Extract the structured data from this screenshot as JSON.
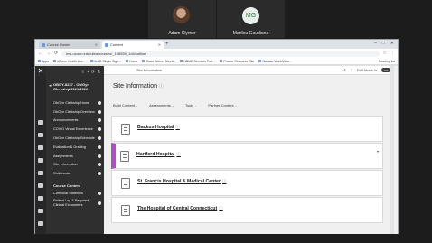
{
  "participants": [
    {
      "name": "Adam Clymer",
      "avatar_type": "photo"
    },
    {
      "name": "Marilou Gaudiana",
      "initials": "MG"
    }
  ],
  "browser": {
    "tabs": [
      {
        "label": "Course Roster",
        "active": false
      },
      {
        "label": "Content",
        "active": true
      }
    ],
    "new_tab": "+",
    "url": "lms.uconn.edu/ultra/courses/_108559_1/cl/outline",
    "bookmarks": [
      "Apps",
      "UConn Health Acc...",
      "NetID Single Sign...",
      "Home",
      "Cisco Webex Meeti...",
      "NBME Services Port...",
      "Proctor Resource Site",
      "Novasu WorldView...",
      "Reading list"
    ]
  },
  "course": {
    "title": "OBGY-8237 - Ob/Gyn Clerkship 2021/2022",
    "header_crumb": "OBGY-8237 - Ob/Gyn Clerkship 2021/2022",
    "nav_items": [
      "ObGyn Clerkship Home",
      "ObGyn Clerkship Overview",
      "Announcements",
      "COVID Virtual Experience",
      "ObGyn Clerkship Schedule",
      "Evaluation & Grading",
      "Assignments",
      "Site Information",
      "Collaborate"
    ],
    "section_label": "Course Content",
    "section_items": [
      "Curricular Materials",
      "Patient Log & Required Clinical Encounters"
    ]
  },
  "main": {
    "crumb": "Site Information",
    "edit_mode_label": "Edit Mode is",
    "edit_mode_state": "ON",
    "title": "Site Information",
    "menus": [
      "Build Content",
      "Assessments",
      "Tools",
      "Partner Content"
    ],
    "items": [
      {
        "label": "Backus Hospital",
        "highlight": false
      },
      {
        "label": "Hartford Hospital",
        "highlight": true
      },
      {
        "label": "St. Francis Hospital & Medical Center",
        "highlight": false
      },
      {
        "label": "The Hospital of Central Connecticut",
        "highlight": false
      }
    ],
    "highlight_color": "#b44bc6"
  }
}
